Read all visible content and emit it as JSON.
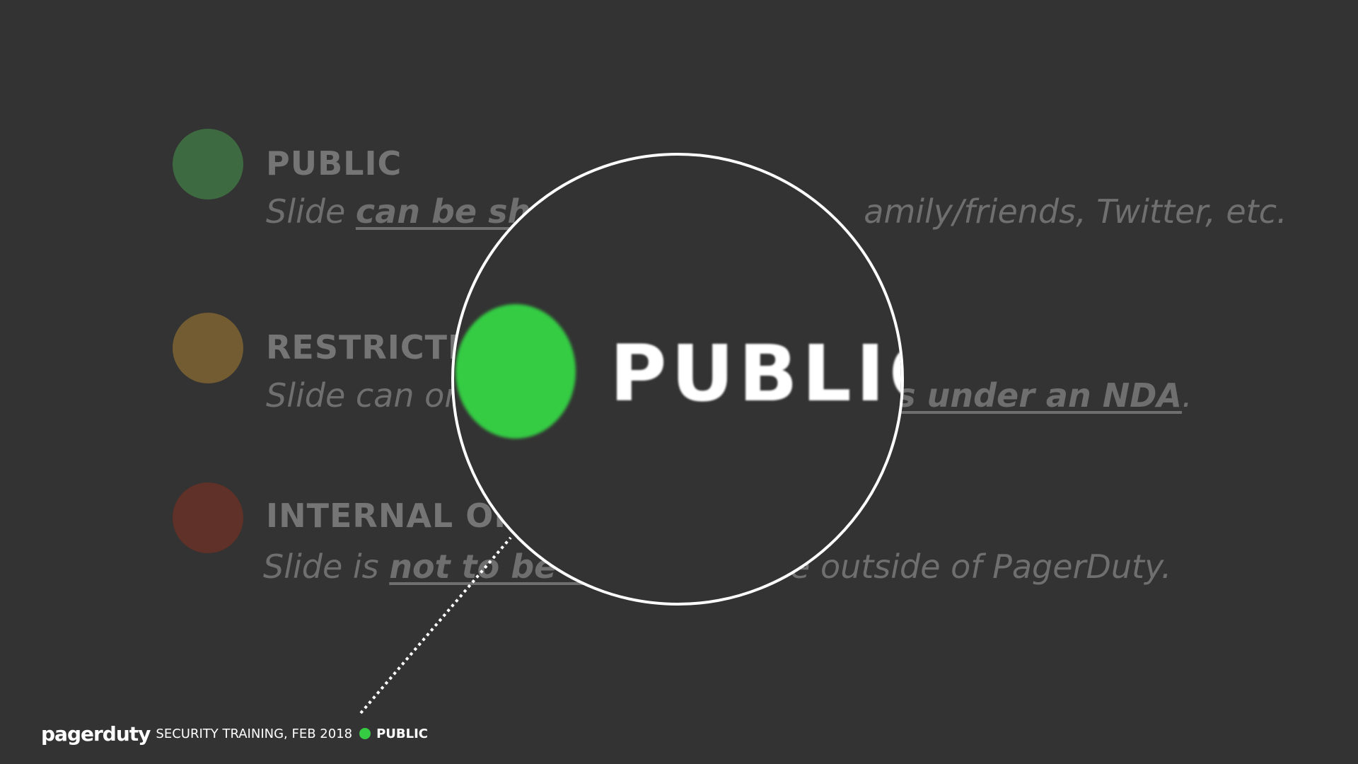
{
  "colors": {
    "background": "#333333",
    "public_dim": "#3d6a40",
    "restricted_dim": "#735c32",
    "internal_dim": "#5f3128",
    "public_bright": "#35cc44",
    "magnifier_border": "#ffffff"
  },
  "levels": [
    {
      "heading": "PUBLIC",
      "desc_pre": "Slide ",
      "desc_emph": "can be sha",
      "desc_post": "amily/friends, Twitter, etc."
    },
    {
      "heading": "RESTRICTE",
      "desc_pre": "Slide can or",
      "desc_emph": "s under an NDA",
      "desc_post": "."
    },
    {
      "heading": "INTERNAL ON",
      "desc_pre": "Slide is ",
      "desc_emph": "not to be s",
      "desc_post": "one outside of PagerDuty."
    }
  ],
  "magnifier": {
    "label": "PUBLIC",
    "dot_color": "#35cc44"
  },
  "footer": {
    "logo": "pagerduty",
    "text": "SECURITY TRAINING, FEB 2018",
    "label": "PUBLIC",
    "dot_color": "#35cc44"
  }
}
